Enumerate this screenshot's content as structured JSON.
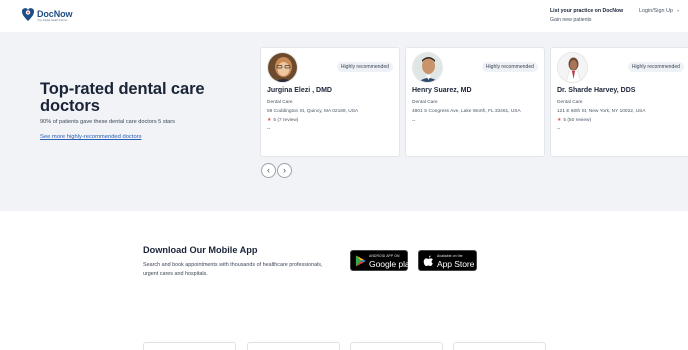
{
  "header": {
    "logo_text": "DocNow",
    "logo_tagline": "Your Digital Health Partner",
    "list_practice_title": "List your practice on DocNow",
    "list_practice_sub": "Gain new patients",
    "login_label": "Login/Sign Up",
    "login_icon": "chevron-down-icon"
  },
  "hero": {
    "title": "Top-rated dental care doctors",
    "subtitle": "90% of patients gave these dental care doctors 5 stars",
    "link": "See more highly-recommended doctors"
  },
  "doctors": [
    {
      "name": "Jurgina Elezi , DMD",
      "badge": "Highly recommended",
      "specialty": "Dental Care",
      "address": "59 Coddington St, Quincy, MA 02169, USA",
      "rating": "5",
      "reviews": "(7 review)",
      "dots": "--"
    },
    {
      "name": "Henry Suarez, MD",
      "badge": "Highly recommended",
      "specialty": "Dental Care",
      "address": "4801 S Congress Ave, Lake Worth, FL 33461, USA",
      "rating": "",
      "reviews": "",
      "dots": "--"
    },
    {
      "name": "Dr. Sharde Harvey, DDS",
      "badge": "Highly recommended",
      "specialty": "Dental Care",
      "address": "121 E 60th St, New York, NY 10022, USA",
      "rating": "5",
      "reviews": "(50 review)",
      "dots": "--"
    }
  ],
  "carousel": {
    "prev": "‹",
    "next": "›"
  },
  "app": {
    "title": "Download Our Mobile App",
    "description": "Search and book appointments with thousands of healthcare professionals, urgent cares and hospitals.",
    "google_small": "ANDROID APP ON",
    "google_big": "Google play",
    "apple_small": "Available on the",
    "apple_big": "App Store"
  },
  "colors": {
    "hero_bg": "#f1f3f7",
    "link": "#2b5fb3",
    "star": "#e0564c",
    "brand": "#1f4e86"
  }
}
